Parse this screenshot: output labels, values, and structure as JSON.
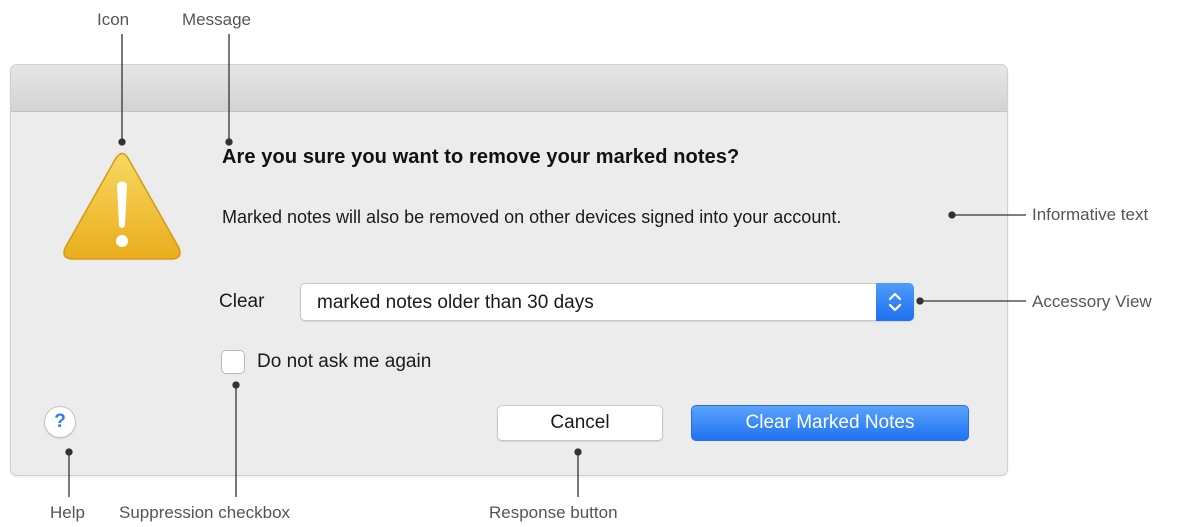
{
  "callouts": {
    "icon": "Icon",
    "message": "Message",
    "informative_text": "Informative text",
    "accessory_view": "Accessory View",
    "help": "Help",
    "suppression_checkbox": "Suppression checkbox",
    "response_button": "Response button"
  },
  "dialog": {
    "message": "Are you sure you want to remove your marked notes?",
    "informative_text": "Marked notes will also be removed on other devices signed into your account.",
    "accessory": {
      "label": "Clear",
      "selected_option": "marked notes older than 30 days"
    },
    "suppression_checkbox": {
      "label": "Do not ask me again",
      "checked": false
    },
    "help_glyph": "?",
    "buttons": {
      "cancel": "Cancel",
      "default": "Clear Marked Notes"
    },
    "icon": "warning-triangle-icon"
  },
  "colors": {
    "accent_blue": "#1f72f2",
    "warning_yellow": "#f2c12e",
    "dialog_background": "#ececec"
  }
}
